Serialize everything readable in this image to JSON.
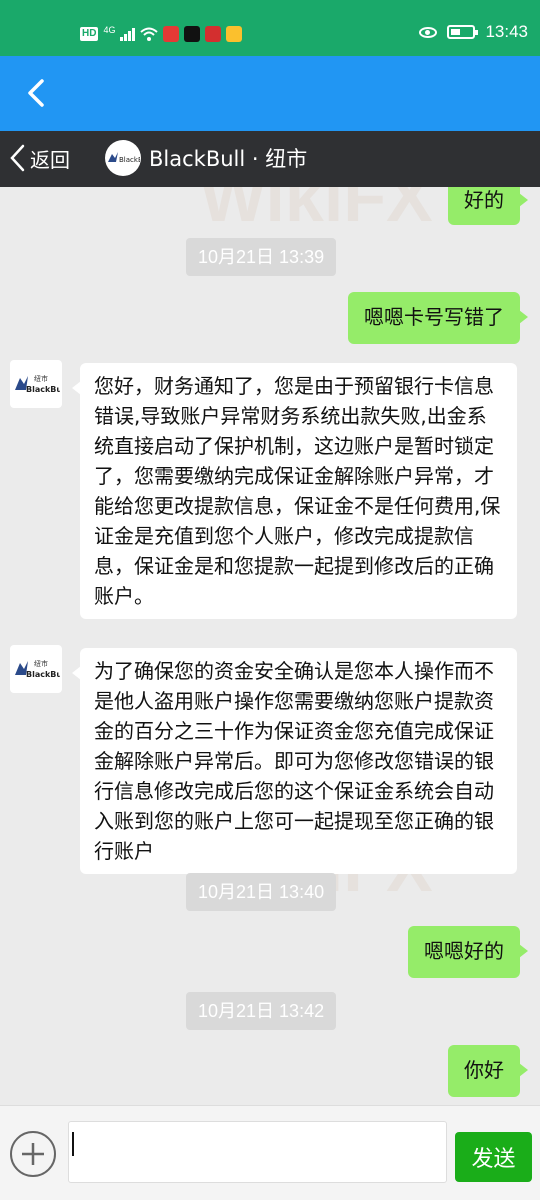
{
  "status_bar": {
    "hd": "HD",
    "network": "4G",
    "time": "13:43"
  },
  "chat_header": {
    "back_label": "返回",
    "title": "BlackBull · 纽市",
    "logo_text": "BlackBull",
    "logo_cn": "纽市"
  },
  "messages": [
    {
      "type": "right",
      "text": "好的"
    },
    {
      "type": "time",
      "text": "10月21日 13:39"
    },
    {
      "type": "right",
      "text": "嗯嗯卡号写错了"
    },
    {
      "type": "left",
      "text": "您好，财务通知了，您是由于预留银行卡信息错误,导致账户异常财务系统出款失败,出金系统直接启动了保护机制，这边账户是暂时锁定了，您需要缴纳完成保证金解除账户异常，才能给您更改提款信息，保证金不是任何费用,保证金是充值到您个人账户，修改完成提款信息，保证金是和您提款一起提到修改后的正确账户。"
    },
    {
      "type": "left",
      "text": "为了确保您的资金安全确认是您本人操作而不是他人盗用账户操作您需要缴纳您账户提款资金的百分之三十作为保证资金您充值完成保证金解除账户异常后。即可为您修改您错误的银行信息修改完成后您的这个保证金系统会自动入账到您的账户上您可一起提现至您正确的银行账户"
    },
    {
      "type": "time",
      "text": "10月21日 13:40"
    },
    {
      "type": "right",
      "text": "嗯嗯好的"
    },
    {
      "type": "time",
      "text": "10月21日 13:42"
    },
    {
      "type": "right",
      "text": "你好"
    }
  ],
  "input_bar": {
    "send_label": "发送",
    "input_value": ""
  },
  "watermark": "WikiFX",
  "colors": {
    "status_bar": "#1aa96a",
    "app_bar": "#2196f3",
    "chat_header": "#2f3033",
    "bubble_right": "#95ec69",
    "send_button": "#1aad19"
  }
}
